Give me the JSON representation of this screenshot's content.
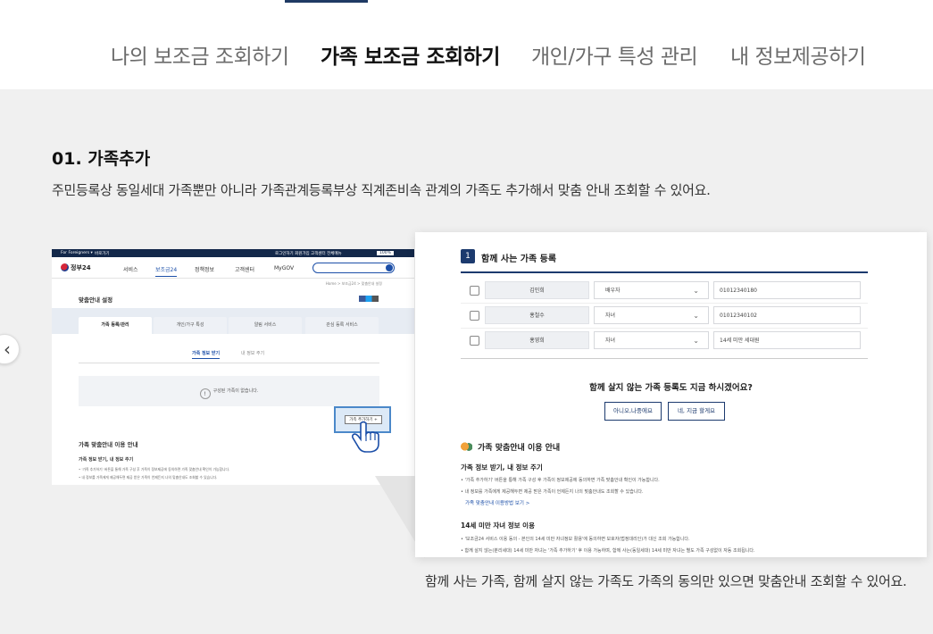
{
  "tabs": [
    {
      "label": "나의 보조금 조회하기",
      "active": false
    },
    {
      "label": "가족 보조금 조회하기",
      "active": true
    },
    {
      "label": "개인/가구 특성 관리",
      "active": false
    },
    {
      "label": "내 정보제공하기",
      "active": false
    }
  ],
  "section": {
    "title": "01. 가족추가",
    "description": "주민등록상 동일세대 가족뿐만 아니라 가족관계등록부상 직계존비속 관계의 가족도 추가해서 맞춤 안내 조회할 수 있어요."
  },
  "caption": "함께 사는 가족, 함께 살지 않는 가족도 가족의 동의만 있으면 맞춤안내 조회할 수 있어요.",
  "icons": {
    "prev": "chevron-left-icon",
    "add_cursor": "hand-pointer-icon"
  },
  "colors": {
    "navy": "#1c3a6e",
    "accent_blue": "#1c4fa8",
    "background": "#f0f0f0"
  },
  "mini": {
    "topbar": {
      "lang": "For Foreigners ▾",
      "site": "바로가기",
      "links": "로그인하기  회원가입  고객센터  전체메뉴",
      "size": "100%"
    },
    "logo": "정부24",
    "nav": [
      "서비스",
      "보조금24",
      "정책정보",
      "고객센터",
      "MyGOV"
    ],
    "breadcrumb": "Home > 보조금24 > 맞춤안내 설정",
    "page_title": "맞춤안내 설정",
    "tabs": [
      "가족 등록/관리",
      "개인/가구 특성",
      "알림 서비스",
      "관심 등록 서비스"
    ],
    "subtabs": [
      "가족 정보 받기",
      "내 정보 주기"
    ],
    "empty": "구성된 가족이 없습니다.",
    "add_button": "가족 추가하기 +",
    "guide_title": "가족 맞춤안내 이용 안내",
    "guide_sub": "가족 정보 받기, 내 정보 주기",
    "guide_lines": [
      "• '가족 추가하기' 버튼을 통해 가족 구성 후 가족이 정보제공에 동의하면 가족 맞춤안내 확인이 가능합니다.",
      "• 내 정보를 가족에게 제공해두면 제공 받은 가족이 언제든지 나의 맞춤안내도 조회할 수 있습니다."
    ]
  },
  "panel": {
    "step": "1",
    "title": "함께 사는 가족 등록",
    "rows": [
      {
        "name": "김민희",
        "relation": "배우자",
        "phone": "01012340180"
      },
      {
        "name": "홍철수",
        "relation": "자녀",
        "phone": "01012340102"
      },
      {
        "name": "홍영희",
        "relation": "자녀",
        "phone": "14세 미만 세대원"
      }
    ],
    "question": "함께 살지 않는 가족 등록도 지금 하시겠어요?",
    "btn_later": "아니오,나중에요",
    "btn_now": "네, 지금 할게요",
    "guide_title": "가족 맞춤안내 이용 안내",
    "guide_sub1": "가족 정보 받기, 내 정보 주기",
    "guide_lines1": [
      "• '가족 추가하기' 버튼을 통해 가족 구성 후 가족이 정보제공에 동의하면 가족 맞춤안내 확인이 가능합니다.",
      "• 내 정보를 가족에게 제공해두면 제공 받은 가족이 언제든지 나의 맞춤안내도 조회할 수 있습니다."
    ],
    "guide_link": "가족 맞춤안내 이용방법 보기 >",
    "guide_sub2": "14세 미만 자녀 정보 이용",
    "guide_lines2": [
      "• '보조금24 서비스 이용 동의 - 본인의 14세 미만 자녀정보 활용'에 동의하면 보호자(법정대리인)가 대신 조회 가능합니다.",
      "• 함께 살지 않는(분리세대) 14세 미만 자녀는 '가족 추가하기' 후 이용 가능하며, 함께 사는(동일세대) 14세 미만 자녀는 별도 가족 구성없이 자동 조회됩니다."
    ]
  }
}
